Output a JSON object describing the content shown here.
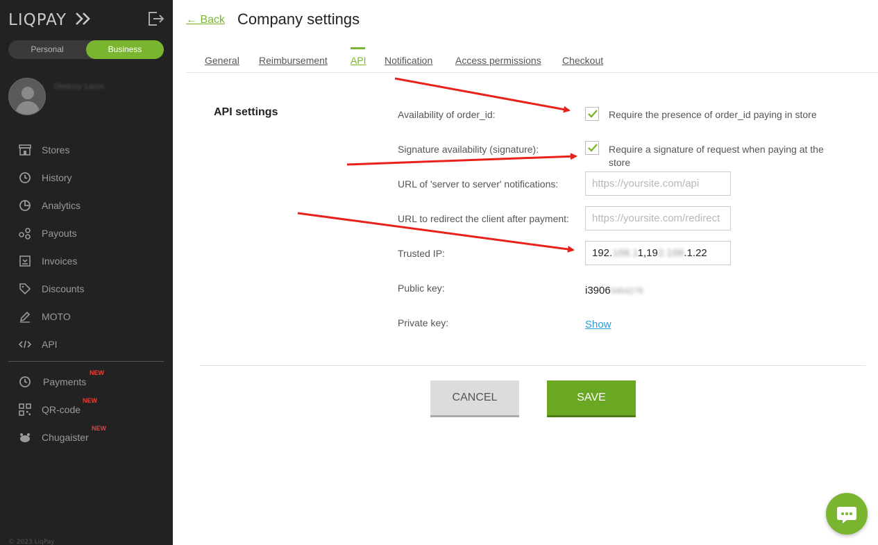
{
  "sidebar": {
    "logo": "LIQPAY",
    "toggle": {
      "personal": "Personal",
      "business": "Business",
      "selected": "Business"
    },
    "username": "Oleksiy Lasin",
    "nav": [
      {
        "label": "Stores",
        "icon": "store-icon"
      },
      {
        "label": "History",
        "icon": "history-icon"
      },
      {
        "label": "Analytics",
        "icon": "pie-chart-icon"
      },
      {
        "label": "Payouts",
        "icon": "payouts-icon"
      },
      {
        "label": "Invoices",
        "icon": "invoice-icon"
      },
      {
        "label": "Discounts",
        "icon": "tag-icon"
      },
      {
        "label": "MOTO",
        "icon": "pen-icon"
      },
      {
        "label": "API",
        "icon": "code-icon"
      }
    ],
    "nav2": [
      {
        "label": "Payments",
        "badge": "NEW",
        "icon": "payments-icon"
      },
      {
        "label": "QR-code",
        "badge": "NEW",
        "icon": "qr-code-icon"
      },
      {
        "label": "Chugaister",
        "badge": "NEW",
        "icon": "chugaister-icon"
      }
    ],
    "copyright": "© 2023 LiqPay"
  },
  "header": {
    "back": "← Back",
    "title": "Company settings"
  },
  "tabs": [
    {
      "label": "General"
    },
    {
      "label": "Reimbursement"
    },
    {
      "label": "API",
      "active": true
    },
    {
      "label": "Notification"
    },
    {
      "label": "Access permissions"
    },
    {
      "label": "Checkout"
    }
  ],
  "api_settings": {
    "title": "API settings",
    "order_id": {
      "label": "Availability of order_id:",
      "checked": true,
      "text": "Require the presence of order_id paying in store"
    },
    "signature": {
      "label": "Signature availability (signature):",
      "checked": true,
      "text": "Require a signature of request when paying at the store"
    },
    "server_url": {
      "label": "URL of 'server to server' notifications:",
      "placeholder": "https://yoursite.com/api",
      "value": ""
    },
    "redirect_url": {
      "label": "URL to redirect the client after payment:",
      "placeholder": "https://yoursite.com/redirect",
      "value": ""
    },
    "trusted_ip": {
      "label": "Trusted IP:",
      "value_a": "192.",
      "value_b": "168.1",
      "value_c": "1,19",
      "value_d": "2.168",
      "value_e": ".1.22"
    },
    "public_key": {
      "label": "Public key:",
      "value_prefix": "i3906",
      "value_hidden": "0454279"
    },
    "private_key": {
      "label": "Private key:",
      "link": "Show"
    }
  },
  "actions": {
    "cancel": "CANCEL",
    "save": "SAVE"
  },
  "colors": {
    "accent": "#7ab52f",
    "save": "#6aa824",
    "sidebar": "#222222",
    "link": "#2a9cd0",
    "annotation": "#e8221a"
  }
}
